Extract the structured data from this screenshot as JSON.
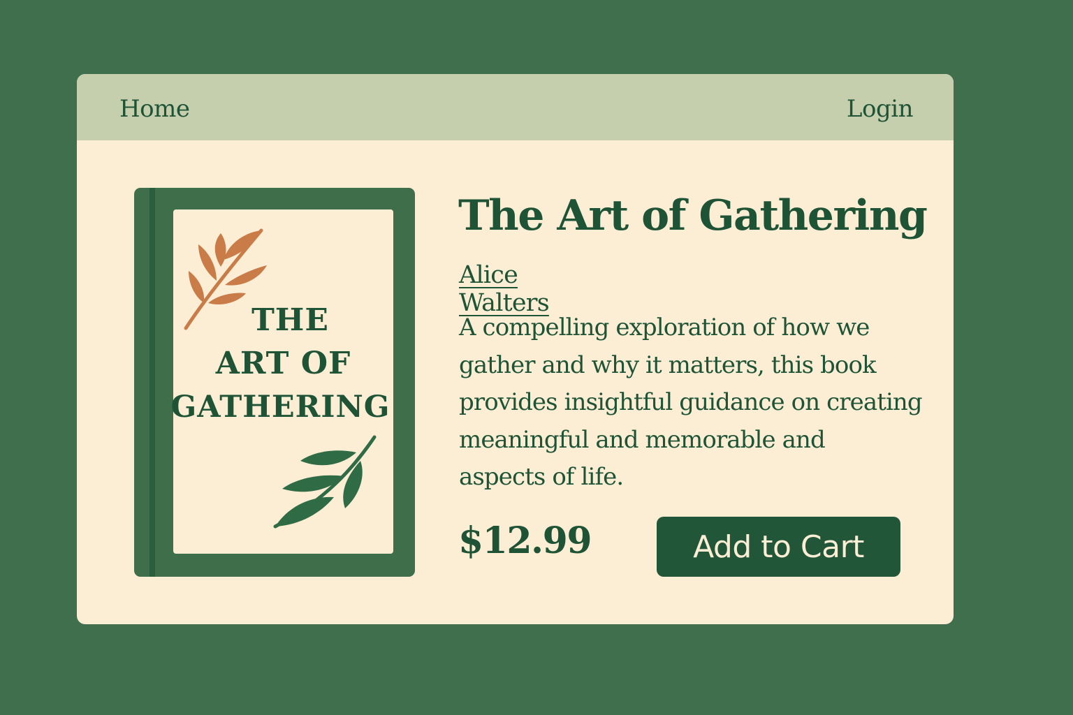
{
  "nav": {
    "home_label": "Home",
    "login_label": "Login"
  },
  "book": {
    "cover": {
      "title_lines": [
        "THE",
        "ART OF",
        "GATHERING"
      ],
      "icons": [
        "orange-branch-icon",
        "green-branch-icon"
      ]
    },
    "title": "The Art of Gathering",
    "author": "Alice Walters",
    "description_lines": [
      "A compelling exploration of how we",
      "gather and why it matters, this book",
      "provides insightful guidance on creating",
      "meaningful and memorable and",
      "aspects of life."
    ],
    "price": "$12.99"
  },
  "cart": {
    "button_label": "Add to Cart"
  },
  "colors": {
    "background": "#3f6f4d",
    "card": "#fbeed5",
    "navbar": "#c5cfae",
    "primary_text": "#1f5335",
    "button": "#215639",
    "leaf_orange": "#c97c48",
    "leaf_green": "#2f6b44"
  }
}
